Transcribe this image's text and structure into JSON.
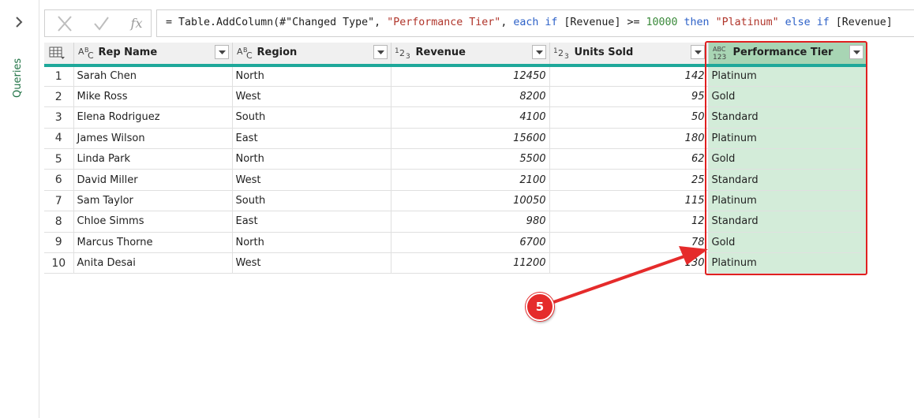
{
  "sidebar": {
    "label": "Queries"
  },
  "formula_bar": {
    "fx_label": "fx",
    "segments": [
      {
        "t": "= Table.AddColumn(#\"Changed Type\", ",
        "c": "plain"
      },
      {
        "t": "\"Performance Tier\"",
        "c": "str"
      },
      {
        "t": ", ",
        "c": "plain"
      },
      {
        "t": "each",
        "c": "kw"
      },
      {
        "t": " ",
        "c": "plain"
      },
      {
        "t": "if",
        "c": "kw"
      },
      {
        "t": " [Revenue] >= ",
        "c": "plain"
      },
      {
        "t": "10000",
        "c": "num"
      },
      {
        "t": " ",
        "c": "plain"
      },
      {
        "t": "then",
        "c": "kw"
      },
      {
        "t": " ",
        "c": "plain"
      },
      {
        "t": "\"Platinum\"",
        "c": "str"
      },
      {
        "t": " ",
        "c": "plain"
      },
      {
        "t": "else",
        "c": "kw"
      },
      {
        "t": " ",
        "c": "plain"
      },
      {
        "t": "if",
        "c": "kw"
      },
      {
        "t": " [Revenue]",
        "c": "plain"
      }
    ]
  },
  "columns": [
    {
      "name": "Rep Name",
      "type": "text"
    },
    {
      "name": "Region",
      "type": "text"
    },
    {
      "name": "Revenue",
      "type": "number"
    },
    {
      "name": "Units Sold",
      "type": "number"
    },
    {
      "name": "Performance Tier",
      "type": "any"
    }
  ],
  "rows": [
    {
      "idx": "1",
      "rep": "Sarah Chen",
      "region": "North",
      "revenue": "12450",
      "units": "142",
      "tier": "Platinum"
    },
    {
      "idx": "2",
      "rep": "Mike Ross",
      "region": "West",
      "revenue": "8200",
      "units": "95",
      "tier": "Gold"
    },
    {
      "idx": "3",
      "rep": "Elena Rodriguez",
      "region": "South",
      "revenue": "4100",
      "units": "50",
      "tier": "Standard"
    },
    {
      "idx": "4",
      "rep": "James Wilson",
      "region": "East",
      "revenue": "15600",
      "units": "180",
      "tier": "Platinum"
    },
    {
      "idx": "5",
      "rep": "Linda Park",
      "region": "North",
      "revenue": "5500",
      "units": "62",
      "tier": "Gold"
    },
    {
      "idx": "6",
      "rep": "David Miller",
      "region": "West",
      "revenue": "2100",
      "units": "25",
      "tier": "Standard"
    },
    {
      "idx": "7",
      "rep": "Sam Taylor",
      "region": "South",
      "revenue": "10050",
      "units": "115",
      "tier": "Platinum"
    },
    {
      "idx": "8",
      "rep": "Chloe Simms",
      "region": "East",
      "revenue": "980",
      "units": "12",
      "tier": "Standard"
    },
    {
      "idx": "9",
      "rep": "Marcus Thorne",
      "region": "North",
      "revenue": "6700",
      "units": "78",
      "tier": "Gold"
    },
    {
      "idx": "10",
      "rep": "Anita Desai",
      "region": "West",
      "revenue": "11200",
      "units": "130",
      "tier": "Platinum"
    }
  ],
  "annotation": {
    "step": "5"
  },
  "colors": {
    "accent": "#217346",
    "highlight": "#e02020",
    "tier_fill": "#d3ecd9",
    "header_rule": "#1ea89a"
  }
}
